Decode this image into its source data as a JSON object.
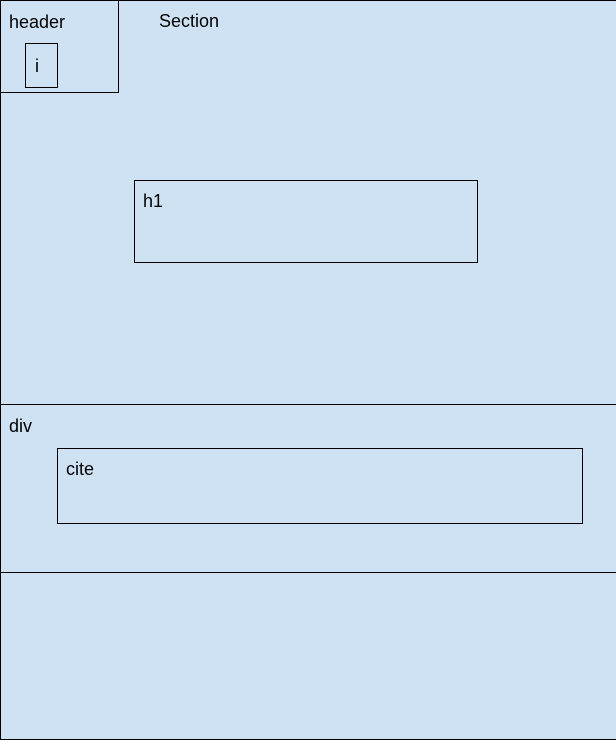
{
  "colors": {
    "fill": "#cfe2f3",
    "stroke": "#000000"
  },
  "section": {
    "label": "Section"
  },
  "header": {
    "label": "header",
    "child": {
      "label": "i"
    }
  },
  "h1": {
    "label": "h1"
  },
  "div": {
    "label": "div",
    "child": {
      "label": "cite"
    }
  }
}
